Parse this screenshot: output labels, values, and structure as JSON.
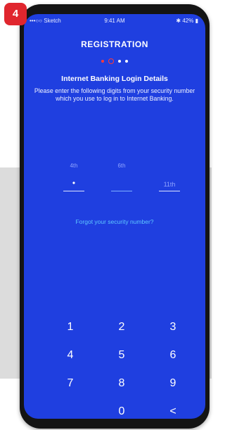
{
  "badge": "4",
  "status": {
    "carrier": "•••○○ Sketch",
    "time": "9:41 AM",
    "battery": "42%"
  },
  "title": "REGISTRATION",
  "heading": "Internet Banking Login Details",
  "instructions": "Please enter the following digits from your security number which you use to log in to Internet Banking.",
  "digits": [
    {
      "label": "4th",
      "value": "•",
      "placeholder": ""
    },
    {
      "label": "6th",
      "value": "",
      "placeholder": ""
    },
    {
      "label": "",
      "value": "",
      "placeholder": "11th"
    }
  ],
  "forgot_link": "Forgot your security number?",
  "keypad": [
    "1",
    "2",
    "3",
    "4",
    "5",
    "6",
    "7",
    "8",
    "9",
    "0",
    "<"
  ],
  "colors": {
    "screen": "#1f3fe0",
    "badge": "#e0262e",
    "link": "#5ec8ff",
    "step_active": "#ff3a3a"
  }
}
